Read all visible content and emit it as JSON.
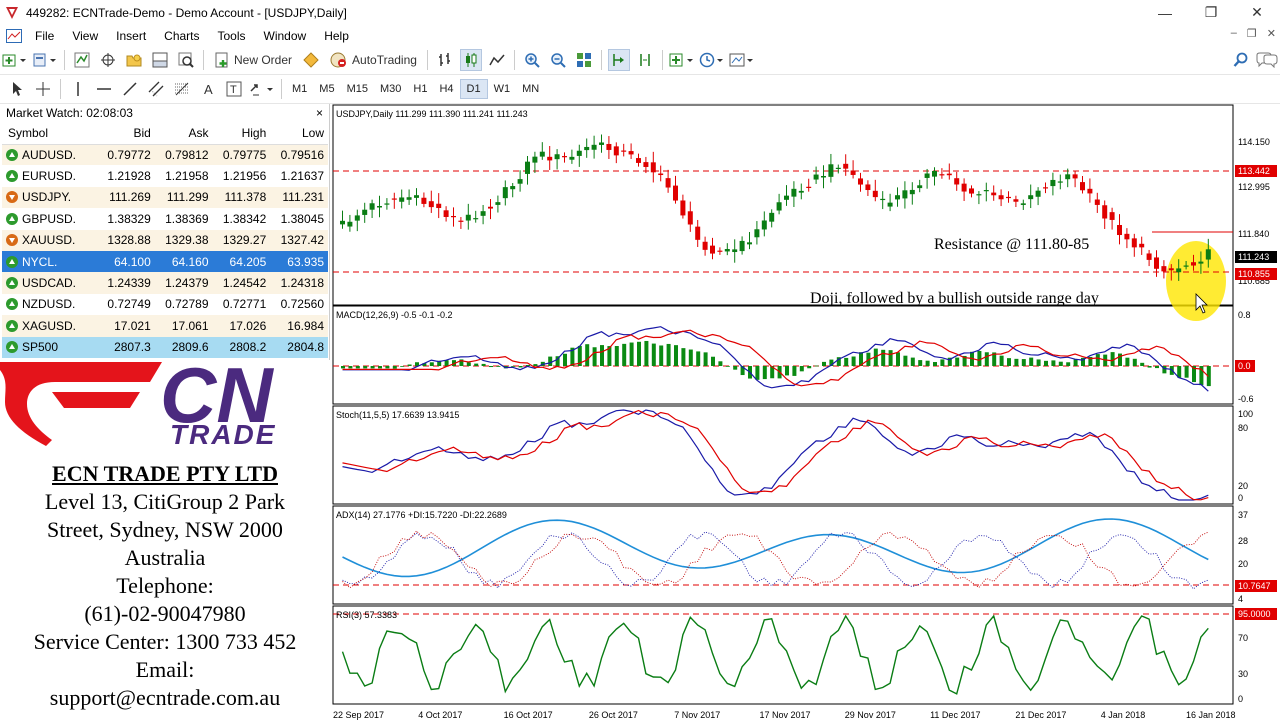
{
  "window": {
    "title": "449282: ECNTrade-Demo - Demo Account - [USDJPY,Daily]",
    "minimize": "—",
    "maximize": "❐",
    "close": "✕"
  },
  "menu": [
    "File",
    "View",
    "Insert",
    "Charts",
    "Tools",
    "Window",
    "Help"
  ],
  "toolbar": {
    "new_order": "New Order",
    "autotrading": "AutoTrading",
    "timeframes": [
      "M1",
      "M5",
      "M15",
      "M30",
      "H1",
      "H4",
      "D1",
      "W1",
      "MN"
    ],
    "active_timeframe": "D1"
  },
  "market_watch": {
    "title": "Market Watch: 02:08:03",
    "close": "×",
    "columns": [
      "Symbol",
      "Bid",
      "Ask",
      "High",
      "Low"
    ],
    "rows": [
      {
        "symbol": "AUDUSD.",
        "bid": "0.79772",
        "ask": "0.79812",
        "high": "0.79775",
        "low": "0.79516",
        "dir": "up"
      },
      {
        "symbol": "EURUSD.",
        "bid": "1.21928",
        "ask": "1.21958",
        "high": "1.21956",
        "low": "1.21637",
        "dir": "up"
      },
      {
        "symbol": "USDJPY.",
        "bid": "111.269",
        "ask": "111.299",
        "high": "111.378",
        "low": "111.231",
        "dir": "dn"
      },
      {
        "symbol": "GBPUSD.",
        "bid": "1.38329",
        "ask": "1.38369",
        "high": "1.38342",
        "low": "1.38045",
        "dir": "up"
      },
      {
        "symbol": "XAUUSD.",
        "bid": "1328.88",
        "ask": "1329.38",
        "high": "1329.27",
        "low": "1327.42",
        "dir": "dn"
      },
      {
        "symbol": "NYCL.",
        "bid": "64.100",
        "ask": "64.160",
        "high": "64.205",
        "low": "63.935",
        "dir": "up"
      },
      {
        "symbol": "USDCAD.",
        "bid": "1.24339",
        "ask": "1.24379",
        "high": "1.24542",
        "low": "1.24318",
        "dir": "up"
      },
      {
        "symbol": "NZDUSD.",
        "bid": "0.72749",
        "ask": "0.72789",
        "high": "0.72771",
        "low": "0.72560",
        "dir": "up"
      },
      {
        "symbol": "XAGUSD.",
        "bid": "17.021",
        "ask": "17.061",
        "high": "17.026",
        "low": "16.984",
        "dir": "up"
      },
      {
        "symbol": "SP500",
        "bid": "2807.3",
        "ask": "2809.6",
        "high": "2808.2",
        "low": "2804.8",
        "dir": "up"
      }
    ],
    "selected_index": 5
  },
  "brand": {
    "logo_top": "CN",
    "logo_bottom": "TRADE",
    "company_name": "ECN TRADE PTY LTD",
    "address_lines": [
      "Level 13, CitiGroup 2 Park",
      "Street, Sydney, NSW 2000",
      "Australia"
    ],
    "telephone_label": "Telephone:",
    "telephone": "(61)-02-90047980",
    "service_center": "Service Center: 1300 733 452",
    "email_label": "Email:",
    "email": "support@ecntrade.com.au",
    "logo_red": "#e4141b",
    "logo_purple": "#4b2a7f"
  },
  "chart": {
    "main_label": "USDJPY,Daily  111.299 111.390 111.241 111.243",
    "price_ticks": [
      "114.150",
      "112.995",
      "111.840",
      "110.685"
    ],
    "price_ticks_y": [
      114.15,
      112.995,
      111.84,
      110.685
    ],
    "resistance_hi": "113.442",
    "resistance_lo": "110.855",
    "current_price": "111.243",
    "annotation_resistance": "Resistance @ 111.80-85",
    "annotation_doji": "Doji, followed by a bullish outside range day",
    "macd_label": "MACD(12,26,9) -0.5 -0.1 -0.2",
    "macd_ticks": [
      "0.8",
      "0.0",
      "-0.6"
    ],
    "stoch_label": "Stoch(11,5,5) 17.6639 13.9415",
    "stoch_ticks": [
      "100",
      "80",
      "20",
      "0"
    ],
    "adx_label": "ADX(14) 27.1776 +DI:15.7220 -DI:22.2689",
    "adx_ticks": [
      "37",
      "28",
      "20",
      "4"
    ],
    "adx_level": "10.7647",
    "rsi_label": "RSI(3) 57.3383",
    "rsi_ticks": [
      "70",
      "30",
      "0"
    ],
    "rsi_level": "95.0000",
    "date_labels": [
      "22 Sep 2017",
      "4 Oct 2017",
      "16 Oct 2017",
      "26 Oct 2017",
      "7 Nov 2017",
      "17 Nov 2017",
      "29 Nov 2017",
      "11 Dec 2017",
      "21 Dec 2017",
      "4 Jan 2018",
      "16 Jan 2018"
    ],
    "bull_color": "#0a7d14",
    "bear_color": "#e00000",
    "macd_color": "#0a8a12",
    "highlight_color": "#ffe600"
  }
}
